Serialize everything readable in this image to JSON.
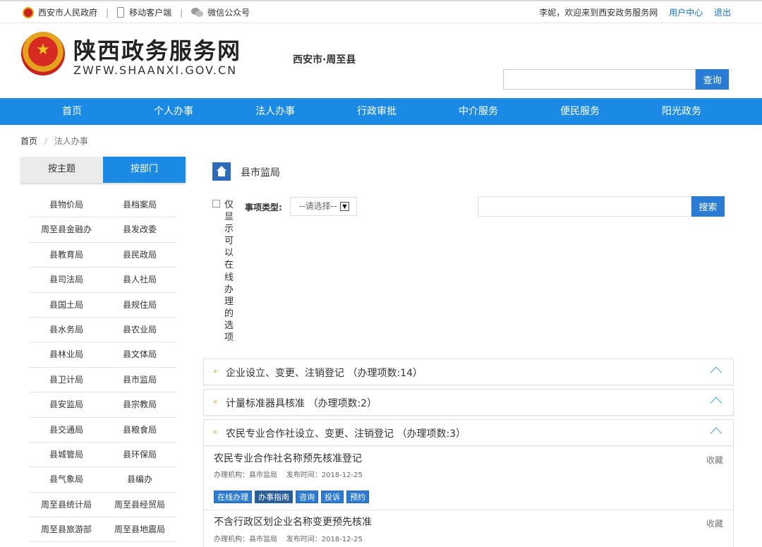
{
  "topbar": {
    "gov_link": "西安市人民政府",
    "mobile_link": "移动客户端",
    "wechat_link": "微信公众号",
    "welcome": "李妮，欢迎来到西安政务服务网",
    "user_center": "用户中心",
    "logout": "退出"
  },
  "header": {
    "site_title": "陕西政务服务网",
    "site_domain": "ZWFW.SHAANXI.GOV.CN",
    "region": "西安市·周至县",
    "search_button": "查询"
  },
  "nav": [
    "首页",
    "个人办事",
    "法人办事",
    "行政审批",
    "中介服务",
    "便民服务",
    "阳光政务"
  ],
  "breadcrumb": {
    "home": "首页",
    "separator": "/",
    "current": "法人办事"
  },
  "sidebar": {
    "tab_theme": "按主题",
    "tab_dept": "按部门",
    "departments": [
      [
        "县物价局",
        "县档案局"
      ],
      [
        "周至县金融办",
        "县发改委"
      ],
      [
        "县教育局",
        "县民政局"
      ],
      [
        "县司法局",
        "县人社局"
      ],
      [
        "县国土局",
        "县规住局"
      ],
      [
        "县水务局",
        "县农业局"
      ],
      [
        "县林业局",
        "县文体局"
      ],
      [
        "县卫计局",
        "县市监局"
      ],
      [
        "县安监局",
        "县宗教局"
      ],
      [
        "县交通局",
        "县粮食局"
      ],
      [
        "县城管局",
        "县环保局"
      ],
      [
        "县气象局",
        "县编办"
      ],
      [
        "周至县统计局",
        "周至县经贸局"
      ],
      [
        "周至县旅游部",
        "周至县地震局"
      ]
    ]
  },
  "content": {
    "title": "县市监局",
    "only_online_label": "仅显示可以在线办理的选项",
    "type_label": "事项类型:",
    "type_select": "--请选择--",
    "search_button": "搜索",
    "categories": [
      {
        "name": "企业设立、变更、注销登记 （办理项数:14）"
      },
      {
        "name": "计量标准器具核准 （办理项数:2）"
      },
      {
        "name": "农民专业合作社设立、变更、注销登记 （办理项数:3）"
      }
    ],
    "items": [
      {
        "title": "农民专业合作社名称预先核准登记",
        "agency_label": "办理机构：县市监局",
        "date_label": "发布时间：2018-12-25",
        "fav": "收藏",
        "buttons": [
          "在线办理",
          "办事指南",
          "咨询",
          "投诉",
          "预约"
        ]
      },
      {
        "title": "不含行政区划企业名称变更预先核准",
        "agency_label": "办理机构：县市监局",
        "date_label": "发布时间：2018-12-25",
        "fav": "收藏"
      }
    ]
  },
  "colors": {
    "nav_blue": "#1b8ae4",
    "button_blue": "#2a7bd4",
    "link_blue": "#1a6fc9",
    "accent_orange": "#e89b2a"
  }
}
